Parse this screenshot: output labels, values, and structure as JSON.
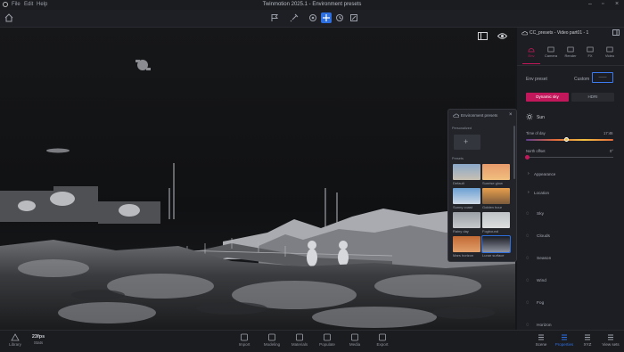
{
  "app": {
    "window_title": "Twinmotion 2025.1 - Environment presets",
    "menu": [
      "File",
      "Edit",
      "Help"
    ]
  },
  "env_popup": {
    "title": "Environment presets",
    "personalized_label": "Personalized",
    "presets_label": "Presets",
    "presets": [
      {
        "label": "Default",
        "colors": [
          "#8aa7c9",
          "#c9c1b3"
        ]
      },
      {
        "label": "Sunrise glow",
        "colors": [
          "#e79a6b",
          "#f1c07f"
        ]
      },
      {
        "label": "Sunny coast",
        "colors": [
          "#6b9fd3",
          "#cfd9e6"
        ]
      },
      {
        "label": "Golden hour",
        "colors": [
          "#e8a04e",
          "#7d5b3c"
        ]
      },
      {
        "label": "Rainy day",
        "colors": [
          "#9aa0a6",
          "#c7c9cc"
        ]
      },
      {
        "label": "Fogbound",
        "colors": [
          "#bfc3c7",
          "#dcdedf"
        ]
      },
      {
        "label": "Mars horizon",
        "colors": [
          "#c26a35",
          "#e2a06a"
        ]
      },
      {
        "label": "Lunar surface",
        "colors": [
          "#1a1c24",
          "#8f94a0"
        ]
      }
    ]
  },
  "right_panel": {
    "title": "CC_presets - Video part01 - 1",
    "tabs": [
      "Env",
      "Camera",
      "Render",
      "FX",
      "Video"
    ],
    "env_preset_label": "Env preset",
    "custom_label": "Custom",
    "custom_value": "——",
    "mode_buttons": [
      "Dynamic sky",
      "HDRI"
    ],
    "sun_section": "Sun",
    "time_of_day_label": "Time of day",
    "time_of_day_value": "17:46",
    "north_offset_label": "North offset",
    "north_offset_value": "0°",
    "time_of_day_fraction": 0.46,
    "north_offset_fraction": 0.02,
    "collapsibles": [
      "Appearance",
      "Location"
    ],
    "sections": [
      "Sky",
      "Clouds",
      "Season",
      "Wind",
      "Fog",
      "Horizon"
    ]
  },
  "bottom_bar": {
    "left": [
      {
        "label": "Library",
        "icon": "library-icon"
      },
      {
        "label": "Stats",
        "icon": "stats-icon",
        "value": "23fps"
      }
    ],
    "center": [
      "Import",
      "Modeling",
      "Materials",
      "Populate",
      "Media",
      "Export"
    ],
    "right": [
      {
        "label": "Scene",
        "icon": "scene-icon"
      },
      {
        "label": "Properties",
        "icon": "properties-icon",
        "active": true
      },
      {
        "label": "XYZ",
        "icon": "xyz-icon"
      },
      {
        "label": "View sets",
        "icon": "view-sets-icon"
      }
    ]
  },
  "colors": {
    "accent_blue": "#2d6fe0",
    "accent_pink": "#c2185b",
    "panel_bg": "#1d1e23"
  }
}
